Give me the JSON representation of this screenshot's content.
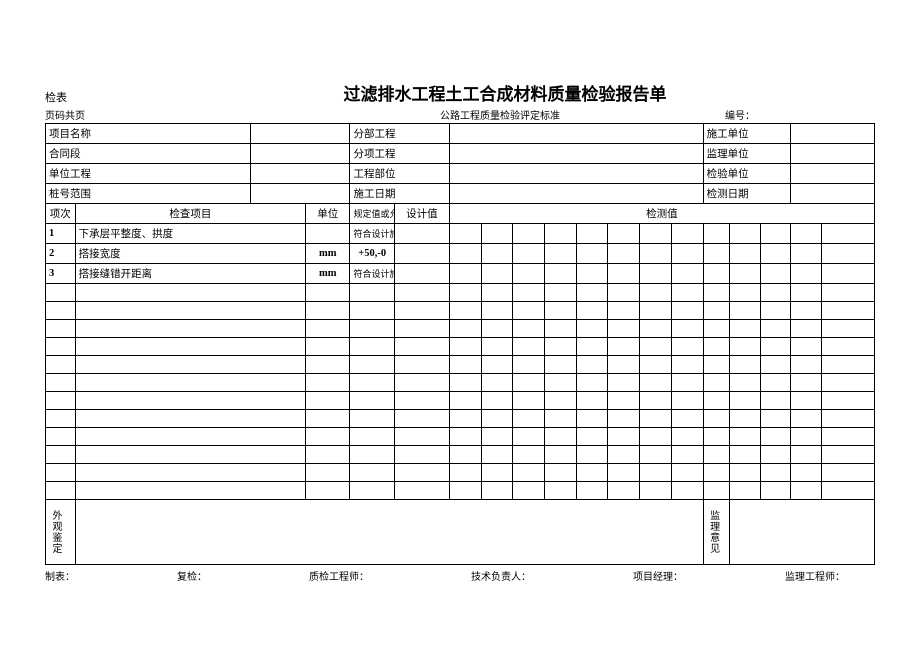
{
  "top_left": "检表",
  "title": "过滤排水工程土工合成材料质量检验报告单",
  "header2_left": "页码共页",
  "header2_center": "公路工程质量检验评定标准",
  "header2_right": "编号：",
  "info_rows": [
    {
      "l1": "项目名称",
      "l2": "分部工程",
      "l3": "施工单位"
    },
    {
      "l1": "合同段",
      "l2": "分项工程",
      "l3": "监理单位"
    },
    {
      "l1": "单位工程",
      "l2": "工程部位",
      "l3": "检验单位"
    },
    {
      "l1": "桩号范围",
      "l2": "施工日期",
      "l3": "检测日期"
    }
  ],
  "cols": {
    "seq": "项次",
    "item": "检查项目",
    "unit": "单位",
    "spec": "规定值或允许偏",
    "design": "设计值",
    "measure": "检测值"
  },
  "items": [
    {
      "n": "1",
      "name": "下承层平整度、拱度",
      "unit": "",
      "spec": "符合设计施工要"
    },
    {
      "n": "2",
      "name": "搭接宽度",
      "unit": "mm",
      "spec": "+50,-0"
    },
    {
      "n": "3",
      "name": "搭接缝错开距离",
      "unit": "mm",
      "spec": "符合设计施工要"
    }
  ],
  "appearance_label": "外观鉴定",
  "supervisor_label": "监理意见",
  "footer": {
    "f1": "制表：",
    "f2": "复检：",
    "f3": "质检工程师：",
    "f4": "技术负责人：",
    "f5": "项目经理：",
    "f6": "监理工程师："
  }
}
